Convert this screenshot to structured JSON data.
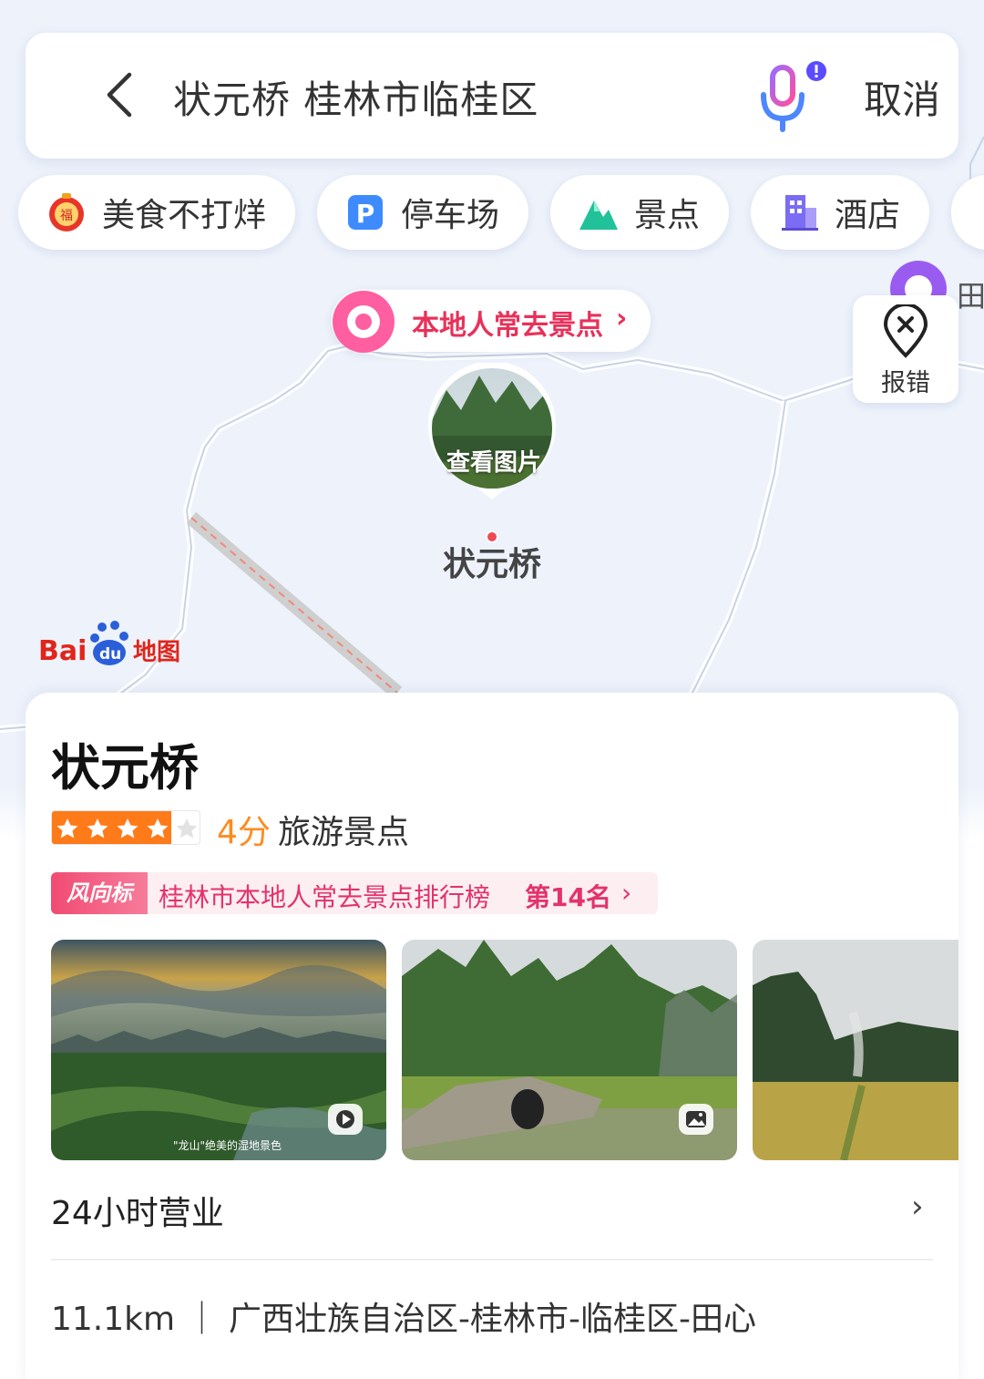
{
  "search": {
    "query": "状元桥 桂林市临桂区",
    "cancel_label": "取消"
  },
  "chips": [
    {
      "label": "美食不打烊",
      "icon": "fortune-lantern-icon"
    },
    {
      "label": "停车场",
      "icon": "parking-icon"
    },
    {
      "label": "景点",
      "icon": "mountain-icon"
    },
    {
      "label": "酒店",
      "icon": "hotel-building-icon"
    }
  ],
  "map": {
    "local_tag": "本地人常去景点",
    "marker_label": "查看图片",
    "poi_name": "状元桥",
    "report_label": "报错",
    "right_poi_text": "田",
    "logo_text": "Bai du 地图"
  },
  "place": {
    "name": "状元桥",
    "rating_fraction": 0.8,
    "score": "4分",
    "category": "旅游景点",
    "rank_badge": "风向标",
    "rank_text": "桂林市本地人常去景点排行榜",
    "rank_position": "第14名",
    "photo_caption": "\"龙山\"绝美的湿地景色",
    "hours": "24小时营业",
    "distance": "11.1km",
    "address": "广西壮族自治区-桂林市-临桂区-田心"
  },
  "colors": {
    "accent_pink": "#e3336b",
    "rating_orange": "#ff7a18",
    "score_orange": "#ff8a1f"
  }
}
